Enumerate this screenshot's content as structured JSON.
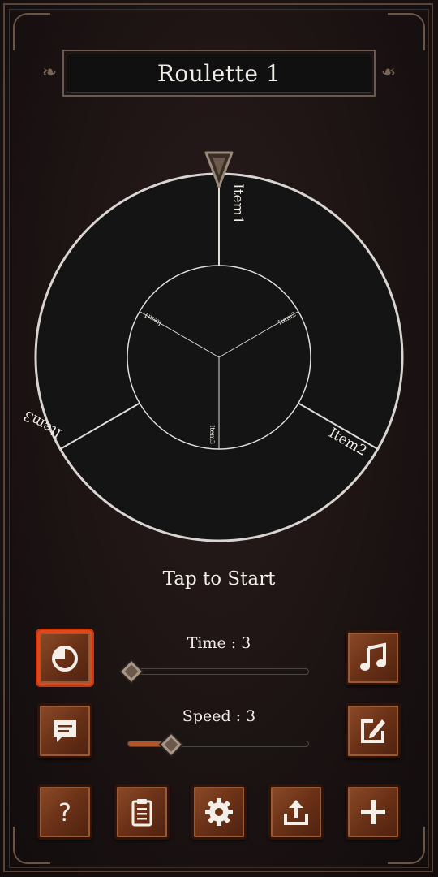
{
  "header": {
    "title": "Roulette 1"
  },
  "wheel": {
    "outer_items": [
      "Item1",
      "Item2",
      "Item3"
    ],
    "inner_items": [
      "Item1",
      "Item2",
      "Item3"
    ],
    "colors": {
      "fill": "#141414",
      "rim": "#d8d4d0",
      "divider": "#e0dcd8",
      "pointer": "#6b5a4c"
    }
  },
  "status": {
    "prompt": "Tap to Start"
  },
  "controls": {
    "time": {
      "label": "Time : 3",
      "fill_fraction": 0.0
    },
    "speed": {
      "label": "Speed : 3",
      "fill_fraction": 0.24
    }
  },
  "buttons": {
    "left": [
      {
        "icon": "history-pie-icon",
        "active": true
      },
      {
        "icon": "chat-bubble-icon",
        "active": false
      }
    ],
    "right": [
      {
        "icon": "music-note-icon"
      },
      {
        "icon": "edit-icon"
      }
    ],
    "bottom": [
      {
        "icon": "help-icon",
        "glyph": "?"
      },
      {
        "icon": "clipboard-icon"
      },
      {
        "icon": "gear-icon"
      },
      {
        "icon": "share-icon"
      },
      {
        "icon": "plus-icon"
      }
    ]
  },
  "colors": {
    "accent": "#e2461a",
    "button": "#7a3b1d",
    "slider_fill": "#b05628"
  }
}
